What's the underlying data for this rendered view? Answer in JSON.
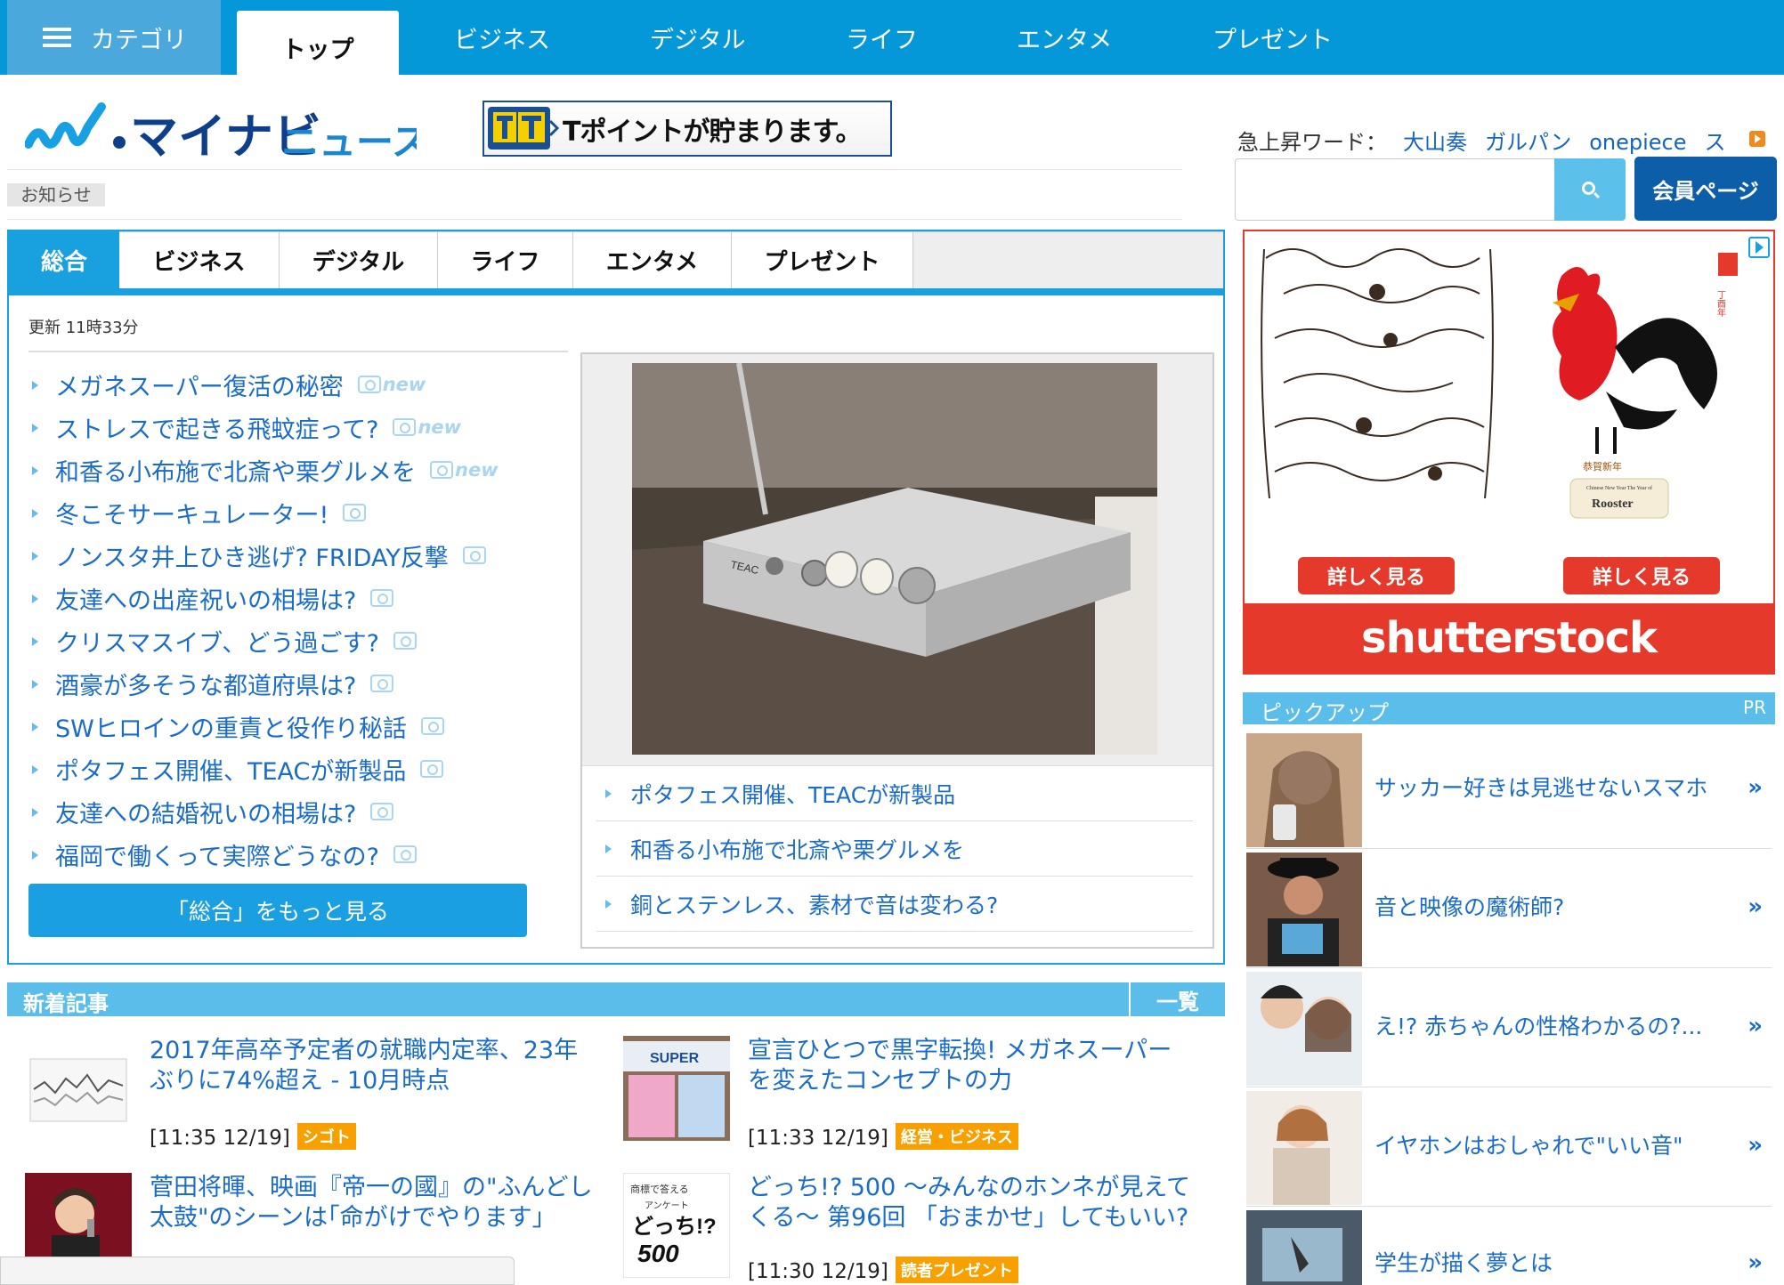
{
  "topnav": {
    "category_label": "カテゴリ",
    "tabs": [
      {
        "label": "トップ",
        "active": true
      },
      {
        "label": "ビジネス"
      },
      {
        "label": "デジタル"
      },
      {
        "label": "ライフ"
      },
      {
        "label": "エンタメ"
      },
      {
        "label": "プレゼント"
      }
    ]
  },
  "header": {
    "logo_text": "マイナビ",
    "logo_sub": "ニュース",
    "banner_text": "Tポイントが貯まります。",
    "notice_label": "お知らせ",
    "trend_label": "急上昇ワード：",
    "trend_words": [
      "大山奏",
      "ガルパン",
      "onepiece",
      "ス"
    ],
    "search_placeholder": "",
    "member_button": "会員ページ"
  },
  "main": {
    "tabs": [
      "総合",
      "ビジネス",
      "デジタル",
      "ライフ",
      "エンタメ",
      "プレゼント"
    ],
    "updated": "更新 11時33分",
    "headlines": [
      {
        "text": "メガネスーパー復活の秘密",
        "new": true
      },
      {
        "text": "ストレスで起きる飛蚊症って?",
        "new": true
      },
      {
        "text": "和香る小布施で北斎や栗グルメを",
        "new": true
      },
      {
        "text": "冬こそサーキュレーター!",
        "new": false
      },
      {
        "text": "ノンスタ井上ひき逃げ? FRIDAY反撃",
        "new": false
      },
      {
        "text": "友達への出産祝いの相場は?",
        "new": false
      },
      {
        "text": "クリスマスイブ、どう過ごす?",
        "new": false
      },
      {
        "text": "酒豪が多そうな都道府県は?",
        "new": false
      },
      {
        "text": "SWヒロインの重責と役作り秘話",
        "new": false
      },
      {
        "text": "ポタフェス開催、TEACが新製品",
        "new": false
      },
      {
        "text": "友達への結婚祝いの相場は?",
        "new": false
      },
      {
        "text": "福岡で働くって実際どうなの?",
        "new": false
      }
    ],
    "new_tag": "new",
    "more_button": "「総合」をもっと見る",
    "feature_list": [
      "ポタフェス開催、TEACが新製品",
      "和香る小布施で北斎や栗グルメを",
      "銅とステンレス、素材で音は変わる?"
    ],
    "feature_brand": "TEAC"
  },
  "new_articles": {
    "title": "新着記事",
    "list_link": "一覧",
    "items": [
      {
        "title": "2017年高卒予定者の就職内定率、23年ぶりに74%超え - 10月時点",
        "time": "[11:35 12/19]",
        "tag": "シゴト"
      },
      {
        "title": "宣言ひとつで黒字転換! メガネスーパーを変えたコンセプトの力",
        "time": "[11:33 12/19]",
        "tag": "経営・ビジネス"
      },
      {
        "title": "菅田将暉、映画『帝一の國』の\"ふんどし太鼓\"のシーンは｢命がけでやります｣",
        "time": "",
        "tag": ""
      },
      {
        "title": "どっち!? 500 〜みんなのホンネが見えてくる〜 第96回 「おまかせ」してもいい?",
        "time": "[11:30 12/19]",
        "tag": "読者プレゼント"
      }
    ],
    "thumb_texts": {
      "super": "SUPER",
      "dotchi_top": "商標で答える",
      "dotchi_mid": "アンケート",
      "dotchi_main": "どっち!?",
      "dotchi_num": "500"
    }
  },
  "ad": {
    "button_left": "詳しく見る",
    "button_right": "詳しく見る",
    "brand": "shutterstock",
    "rooster_label": "Rooster",
    "rooster_sub": "Chinese New Year The Year of",
    "stamp_text": "丁酉年",
    "greeting": "恭賀新年"
  },
  "pickup": {
    "title": "ピックアップ",
    "pr": "PR",
    "items": [
      {
        "text": "サッカー好きは見逃せないスマホ"
      },
      {
        "text": "音と映像の魔術師?"
      },
      {
        "text": "え!? 赤ちゃんの性格わかるの?..."
      },
      {
        "text": "イヤホンはおしゃれで\"いい音\""
      },
      {
        "text": "学生が描く夢とは"
      }
    ],
    "chevron": "»"
  },
  "colors": {
    "nav_blue": "#0598d9",
    "link_blue": "#1a6cc9",
    "tab_blue": "#19a0df",
    "badge_orange": "#f7a000",
    "ad_red": "#e53a2b",
    "member_blue": "#0d5ea8"
  }
}
